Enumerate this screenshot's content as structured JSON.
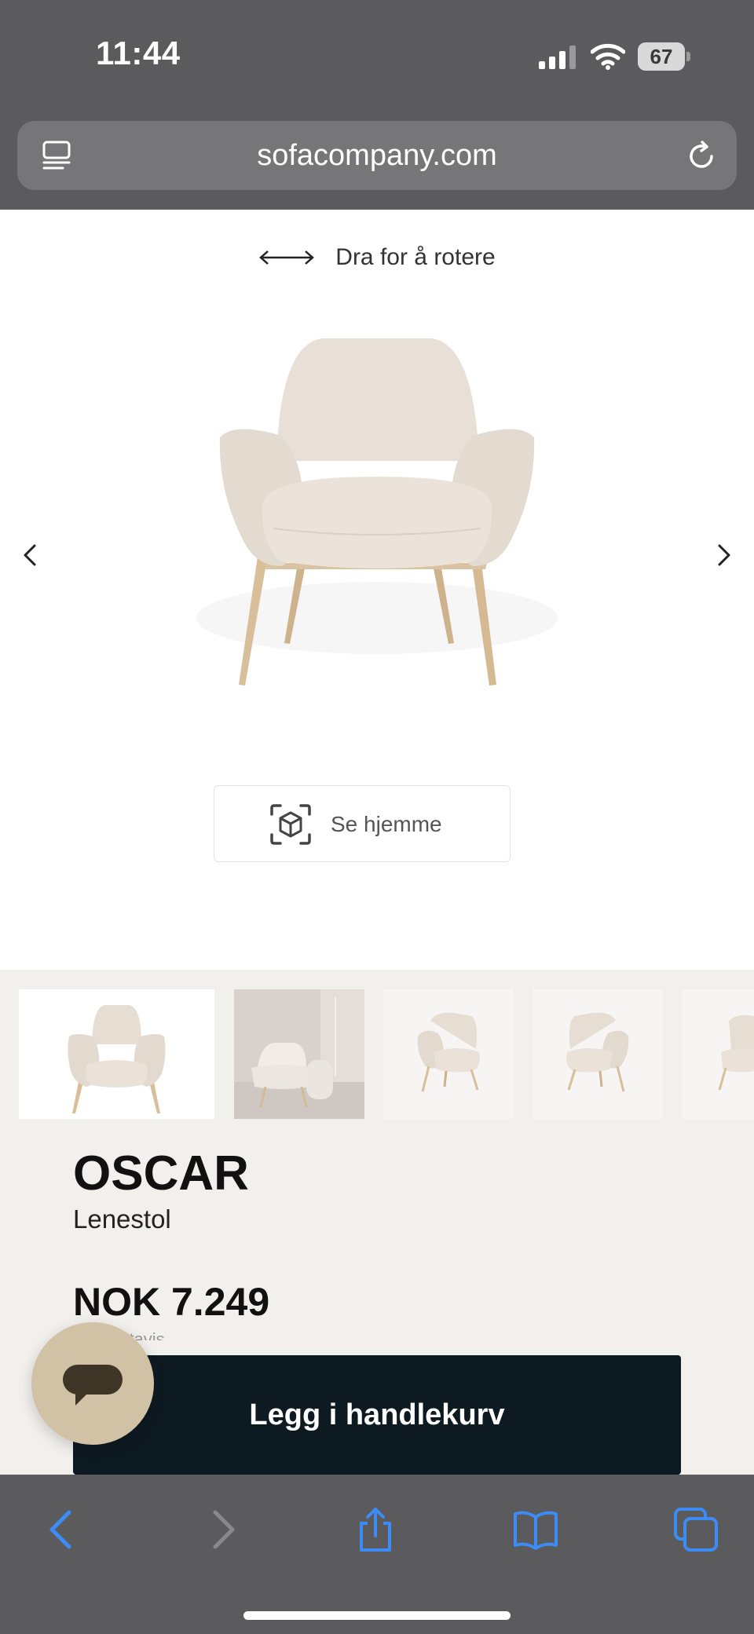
{
  "status_bar": {
    "time": "11:44",
    "battery_level": "67"
  },
  "browser": {
    "url": "sofacompany.com",
    "icons": {
      "tabs_overview": "sidebar-icon",
      "reload": "reload-icon",
      "back": "chevron-left-icon",
      "forward": "chevron-right-icon",
      "share": "share-icon",
      "bookmarks": "book-icon",
      "tabs": "tabs-icon"
    },
    "accent_color": "#3d8bf5",
    "disabled_color": "#8a8a8c"
  },
  "viewer": {
    "rotate_hint": "Dra for å rotere",
    "ar_button_label": "Se hjemme"
  },
  "product": {
    "name": "OSCAR",
    "type": "Lenestol",
    "price": "NOK 7.249",
    "price_subtext": "... tavis",
    "add_to_cart_label": "Legg i handlekurv",
    "colors": {
      "fabric": "#e6ddd3",
      "legs": "#d8bf9a",
      "cart_button": "#0e1a22",
      "chat_button": "#d1c2a6"
    }
  },
  "thumbnails": [
    {
      "alt": "chair-front"
    },
    {
      "alt": "chair-room-scene"
    },
    {
      "alt": "chair-angle-left"
    },
    {
      "alt": "chair-angle-right"
    },
    {
      "alt": "chair-side"
    }
  ]
}
